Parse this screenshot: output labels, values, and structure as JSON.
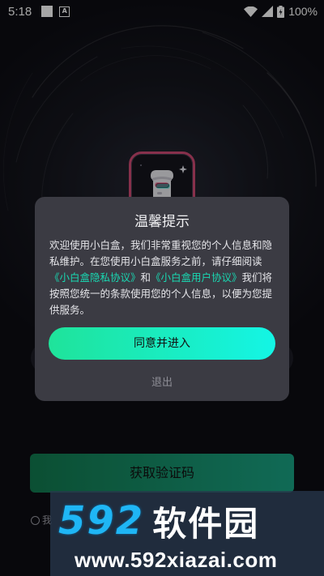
{
  "status_bar": {
    "time": "5:18",
    "battery_percent": "100%",
    "icons": [
      "notification-square-icon",
      "a-badge-icon",
      "wifi-icon",
      "signal-icon",
      "battery-icon"
    ],
    "a_badge": "A"
  },
  "app": {
    "logo_icon": "toast-character-icon"
  },
  "login": {
    "get_code_button": "获取验证码",
    "agree_prefix": "我"
  },
  "dialog": {
    "title": "温馨提示",
    "body_text_1": "欢迎使用小白盒，我们非常重视您的个人信息和隐私维护。在您使用小白盒服务之前，请仔细阅读",
    "privacy_link": "《小白盒隐私协议》",
    "and_text": "和",
    "user_link": "《小白盒用户协议》",
    "body_text_2": "我们将按照您统一的条款使用您的个人信息，以便为您提供服务。",
    "agree_button": "同意并进入",
    "exit_button": "退出"
  },
  "watermark": {
    "number": "592",
    "name": "软件园",
    "url": "www.592xiazai.com"
  },
  "colors": {
    "accent_start": "#1fe39a",
    "accent_end": "#14f5e5",
    "link": "#19d8b2",
    "dialog_bg": "#3b3b43"
  }
}
